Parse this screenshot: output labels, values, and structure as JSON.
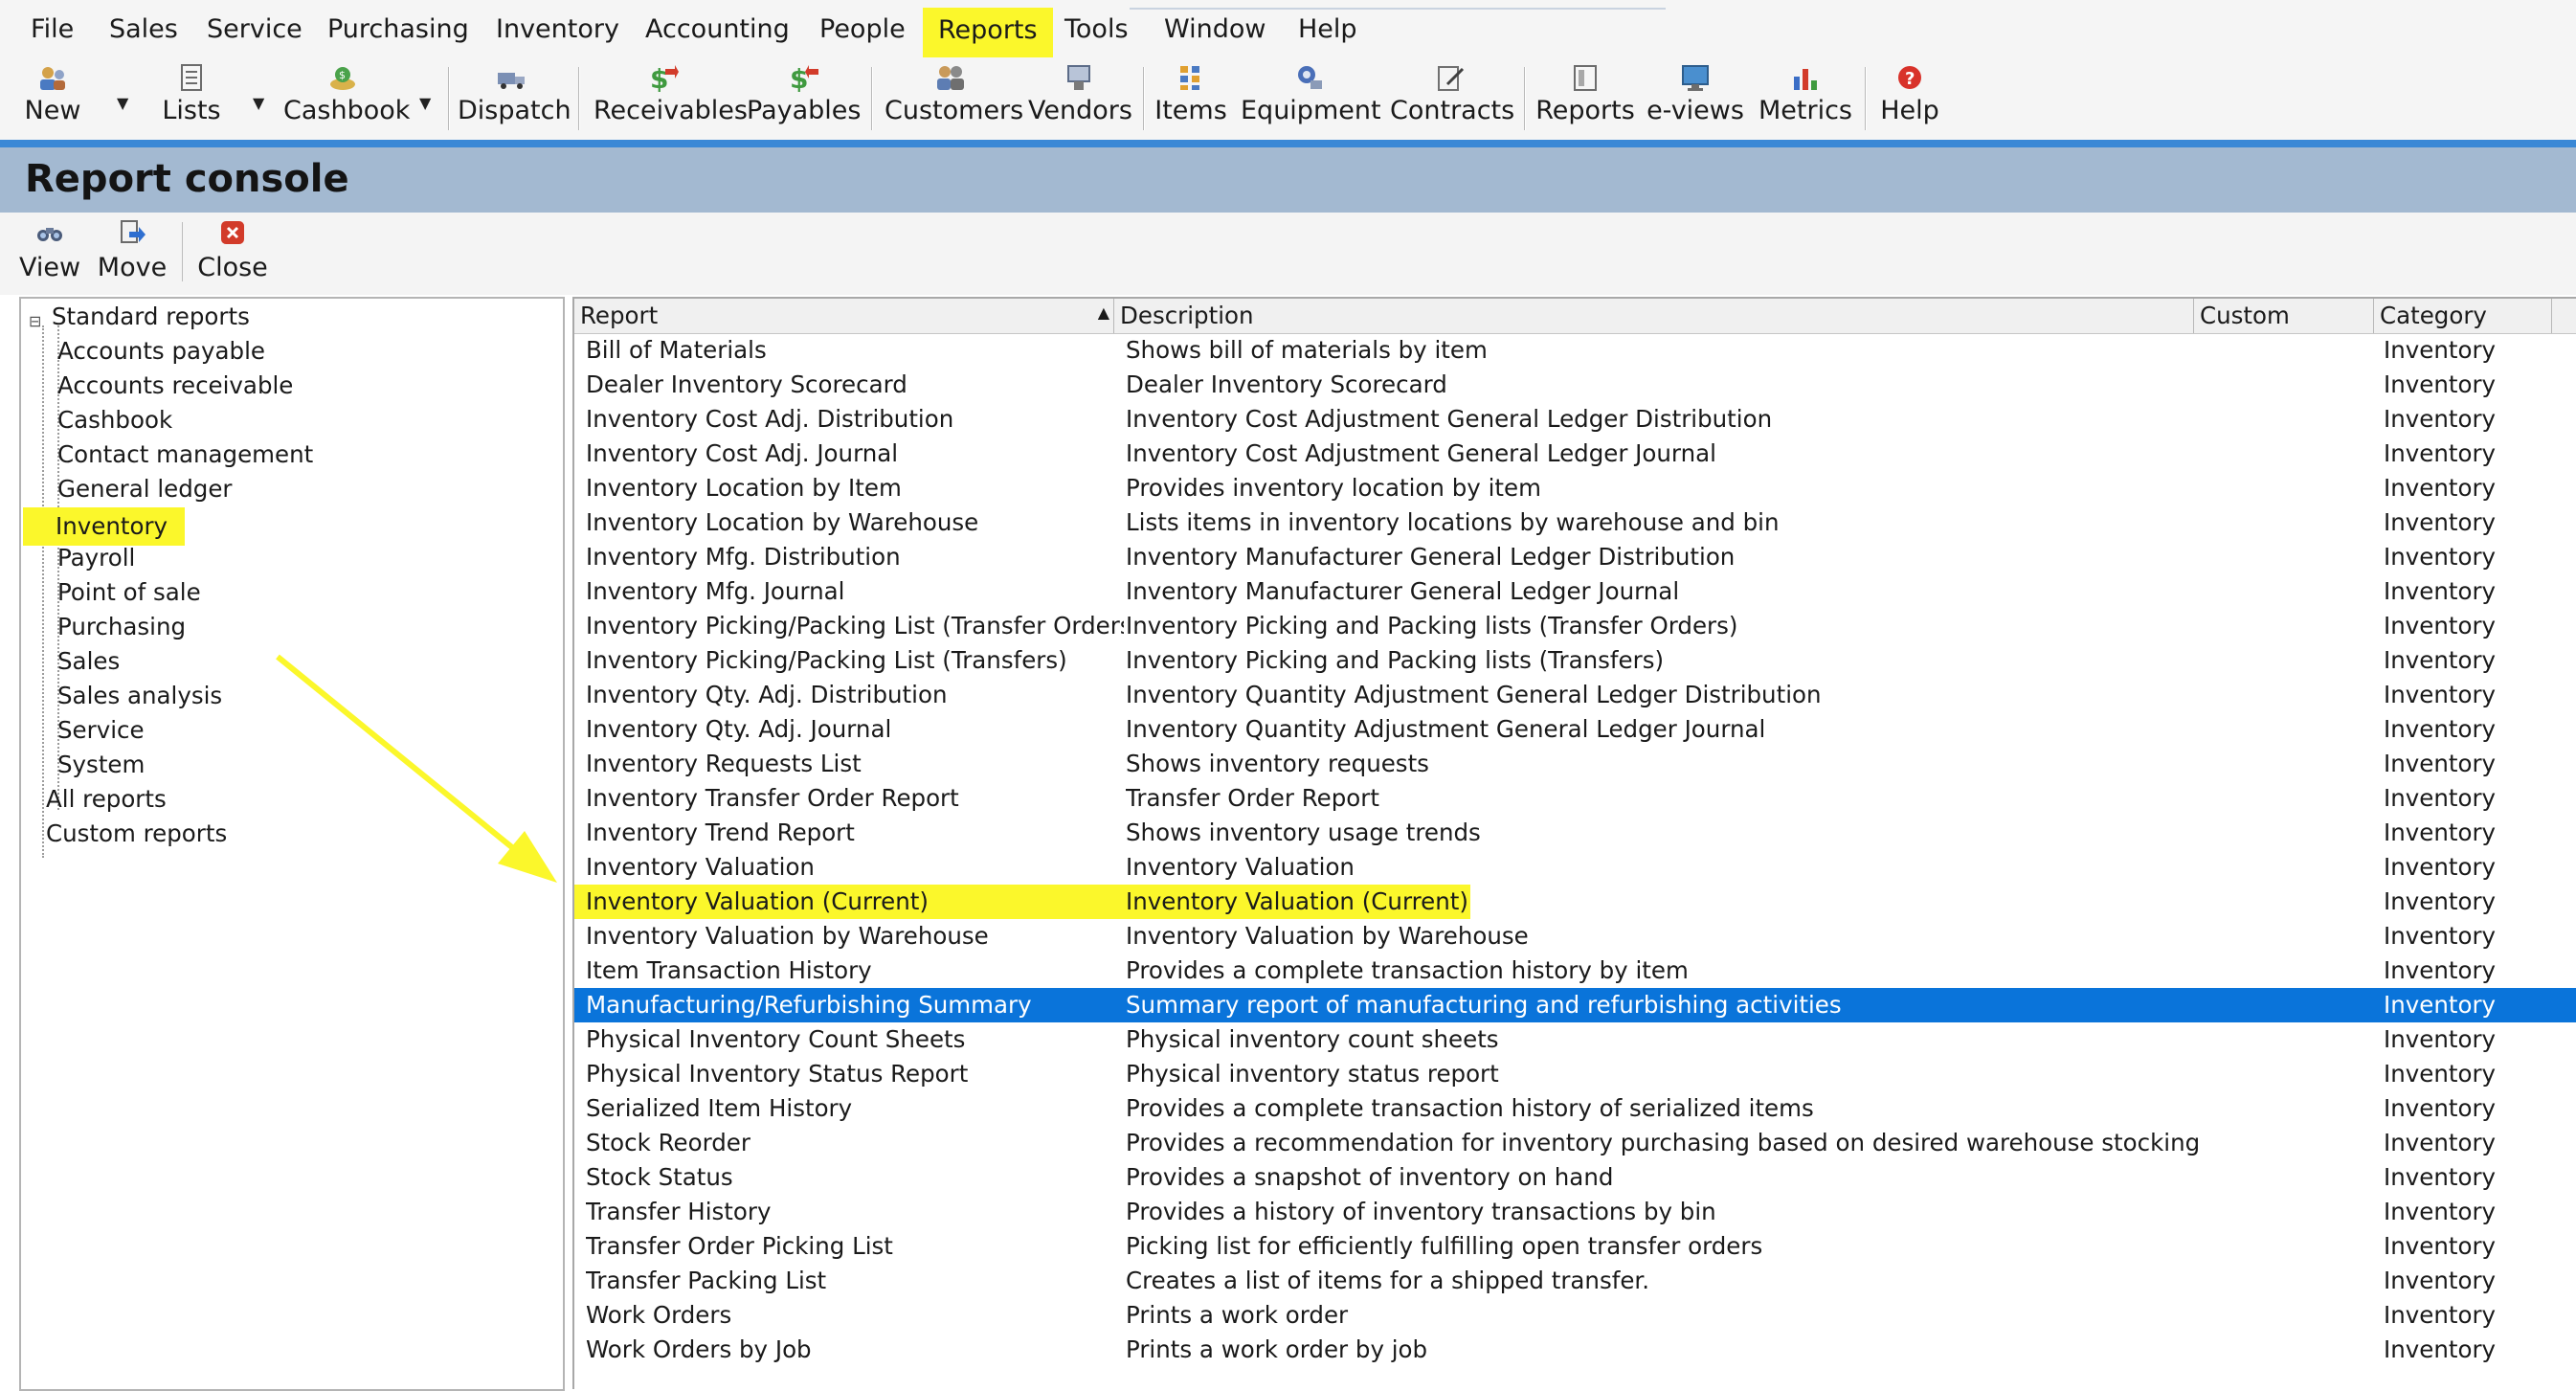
{
  "menu": {
    "items": [
      "File",
      "Sales",
      "Service",
      "Purchasing",
      "Inventory",
      "Accounting",
      "People",
      "Reports",
      "Tools",
      "Window",
      "Help"
    ],
    "highlighted": "Reports"
  },
  "toolbar": {
    "buttons": [
      {
        "label": "New",
        "icon": "new-icon"
      },
      {
        "label": "Lists",
        "icon": "lists-icon"
      },
      {
        "label": "Cashbook",
        "icon": "cashbook-icon"
      },
      {
        "label": "Dispatch",
        "icon": "dispatch-truck-icon"
      },
      {
        "label": "Receivables",
        "icon": "receivables-dollar-icon"
      },
      {
        "label": "Payables",
        "icon": "payables-dollar-icon"
      },
      {
        "label": "Customers",
        "icon": "customers-icon"
      },
      {
        "label": "Vendors",
        "icon": "vendors-icon"
      },
      {
        "label": "Items",
        "icon": "items-icon"
      },
      {
        "label": "Equipment",
        "icon": "equipment-icon"
      },
      {
        "label": "Contracts",
        "icon": "contracts-icon"
      },
      {
        "label": "Reports",
        "icon": "reports-icon"
      },
      {
        "label": "e-views",
        "icon": "e-views-icon"
      },
      {
        "label": "Metrics",
        "icon": "metrics-chart-icon"
      },
      {
        "label": "Help",
        "icon": "help-icon"
      }
    ]
  },
  "console": {
    "title": "Report console",
    "actions": [
      {
        "label": "View",
        "icon": "binoculars-icon"
      },
      {
        "label": "Move",
        "icon": "move-arrow-icon"
      },
      {
        "label": "Close",
        "icon": "close-icon"
      }
    ]
  },
  "tree": {
    "root": "Standard reports",
    "children": [
      "Accounts payable",
      "Accounts receivable",
      "Cashbook",
      "Contact management",
      "General ledger",
      "Inventory",
      "Payroll",
      "Point of sale",
      "Purchasing",
      "Sales",
      "Sales analysis",
      "Service",
      "System"
    ],
    "siblings": [
      "All reports",
      "Custom reports"
    ],
    "highlighted": "Inventory"
  },
  "grid": {
    "columns": {
      "report": "Report",
      "description": "Description",
      "custom": "Custom",
      "category": "Category"
    },
    "rows": [
      {
        "report": "Bill of Materials",
        "description": "Shows bill of materials by item",
        "category": "Inventory"
      },
      {
        "report": "Dealer Inventory Scorecard",
        "description": "Dealer Inventory Scorecard",
        "category": "Inventory"
      },
      {
        "report": "Inventory Cost Adj. Distribution",
        "description": "Inventory Cost Adjustment General Ledger Distribution",
        "category": "Inventory"
      },
      {
        "report": "Inventory Cost Adj. Journal",
        "description": "Inventory Cost Adjustment General Ledger Journal",
        "category": "Inventory"
      },
      {
        "report": "Inventory Location by Item",
        "description": "Provides inventory location by item",
        "category": "Inventory"
      },
      {
        "report": "Inventory Location by Warehouse",
        "description": "Lists items in inventory locations by warehouse and bin",
        "category": "Inventory"
      },
      {
        "report": "Inventory Mfg. Distribution",
        "description": "Inventory Manufacturer General Ledger Distribution",
        "category": "Inventory"
      },
      {
        "report": "Inventory Mfg. Journal",
        "description": "Inventory Manufacturer General Ledger Journal",
        "category": "Inventory"
      },
      {
        "report": "Inventory Picking/Packing List (Transfer Orders)",
        "description": "Inventory Picking and Packing lists (Transfer Orders)",
        "category": "Inventory"
      },
      {
        "report": "Inventory Picking/Packing List (Transfers)",
        "description": "Inventory Picking and Packing lists (Transfers)",
        "category": "Inventory"
      },
      {
        "report": "Inventory Qty. Adj. Distribution",
        "description": "Inventory Quantity Adjustment General Ledger Distribution",
        "category": "Inventory"
      },
      {
        "report": "Inventory Qty. Adj. Journal",
        "description": "Inventory Quantity Adjustment General Ledger Journal",
        "category": "Inventory"
      },
      {
        "report": "Inventory Requests List",
        "description": "Shows inventory requests",
        "category": "Inventory"
      },
      {
        "report": "Inventory Transfer Order Report",
        "description": "Transfer Order Report",
        "category": "Inventory"
      },
      {
        "report": "Inventory Trend Report",
        "description": "Shows inventory usage trends",
        "category": "Inventory"
      },
      {
        "report": "Inventory Valuation",
        "description": "Inventory Valuation",
        "category": "Inventory"
      },
      {
        "report": "Inventory Valuation (Current)",
        "description": "Inventory Valuation (Current)",
        "category": "Inventory",
        "highlight": true
      },
      {
        "report": "Inventory Valuation by Warehouse",
        "description": "Inventory Valuation by Warehouse",
        "category": "Inventory"
      },
      {
        "report": "Item Transaction History",
        "description": "Provides a complete transaction history by item",
        "category": "Inventory"
      },
      {
        "report": "Manufacturing/Refurbishing Summary",
        "description": "Summary report of manufacturing and refurbishing activities",
        "category": "Inventory",
        "selected": true
      },
      {
        "report": "Physical Inventory Count Sheets",
        "description": "Physical inventory count sheets",
        "category": "Inventory"
      },
      {
        "report": "Physical Inventory Status Report",
        "description": "Physical inventory status report",
        "category": "Inventory"
      },
      {
        "report": "Serialized Item History",
        "description": "Provides a complete transaction history of serialized items",
        "category": "Inventory"
      },
      {
        "report": "Stock Reorder",
        "description": "Provides a recommendation for inventory purchasing based on desired warehouse stocking parame...",
        "category": "Inventory"
      },
      {
        "report": "Stock Status",
        "description": "Provides a snapshot of inventory on hand",
        "category": "Inventory"
      },
      {
        "report": "Transfer History",
        "description": "Provides a history of inventory transactions by bin",
        "category": "Inventory"
      },
      {
        "report": "Transfer Order Picking List",
        "description": "Picking list for efficiently fulfilling open transfer orders",
        "category": "Inventory"
      },
      {
        "report": "Transfer Packing List",
        "description": "Creates a list of items for a shipped transfer.",
        "category": "Inventory"
      },
      {
        "report": "Work Orders",
        "description": "Prints a work order",
        "category": "Inventory"
      },
      {
        "report": "Work Orders by Job",
        "description": "Prints a work order by job",
        "category": "Inventory"
      }
    ]
  },
  "colors": {
    "highlight_yellow": "#fbf72b",
    "selection_blue": "#0a74da",
    "console_header": "#a3b9d1",
    "accent_line": "#3a88d6"
  }
}
